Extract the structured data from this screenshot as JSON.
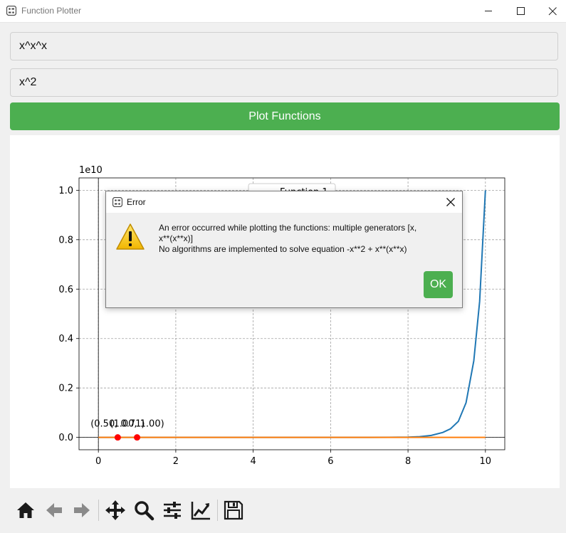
{
  "window": {
    "title": "Function Plotter"
  },
  "inputs": {
    "function1_value": "x^x^x",
    "function2_value": "x^2"
  },
  "plot_button_label": "Plot Functions",
  "dialog": {
    "title": "Error",
    "message": "An error occurred while plotting the functions: multiple generators [x,\nx**(x**x)]\nNo algorithms are implemented to solve equation -x**2 + x**(x**x)",
    "ok_label": "OK"
  },
  "toolbar": {
    "icons": [
      "home-icon",
      "back-arrow-icon",
      "forward-arrow-icon",
      "pan-icon",
      "zoom-icon",
      "configure-subplots-icon",
      "edit-axes-icon",
      "save-icon"
    ]
  },
  "colors": {
    "accent": "#4caf50",
    "series1": "#1f77b4",
    "series2": "#ff7f0e",
    "points": "#ff0000"
  },
  "chart_data": {
    "type": "line",
    "title": "",
    "xlabel": "",
    "ylabel": "",
    "y_scale_label": "1e10",
    "xlim": [
      -0.5,
      10.5
    ],
    "ylim": [
      -0.05,
      1.05
    ],
    "x_ticks": [
      "0",
      "2",
      "4",
      "6",
      "8",
      "10"
    ],
    "y_ticks": [
      "0.0",
      "0.2",
      "0.4",
      "0.6",
      "0.8",
      "1.0"
    ],
    "grid": true,
    "legend_position": "top-center",
    "series": [
      {
        "name": "Function 1",
        "color": "#1f77b4",
        "x": [
          0,
          7.0,
          7.5,
          8.0,
          8.3,
          8.6,
          8.9,
          9.1,
          9.3,
          9.5,
          9.7,
          9.85,
          10.0
        ],
        "y": [
          0,
          0.0001,
          0.0004,
          0.0013,
          0.003,
          0.008,
          0.02,
          0.035,
          0.065,
          0.14,
          0.31,
          0.55,
          1.0
        ]
      },
      {
        "name": "",
        "color": "#ff7f0e",
        "x": [
          0,
          10
        ],
        "y": [
          0,
          0
        ]
      }
    ],
    "points": [
      {
        "x": 0.5,
        "y": 0,
        "label": "(0.50, 0.71)"
      },
      {
        "x": 1.0,
        "y": 0,
        "label": "(1.00, 1.00)"
      }
    ]
  }
}
